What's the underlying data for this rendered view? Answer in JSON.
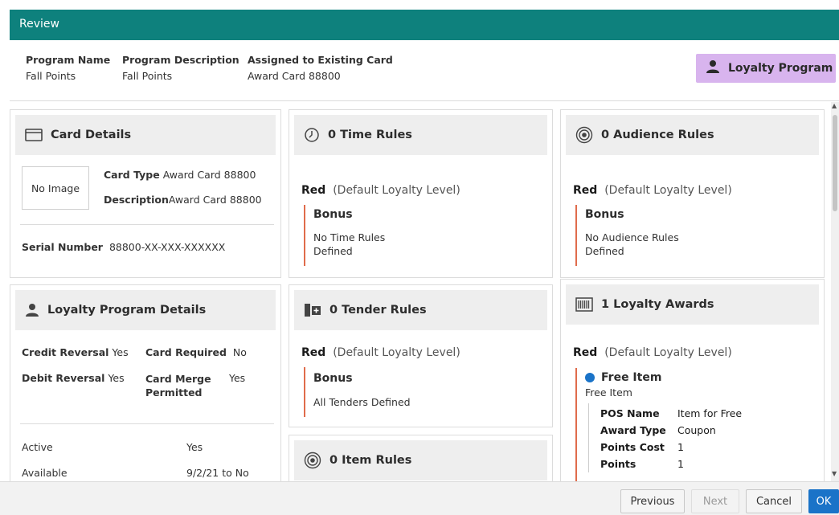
{
  "title": "Review",
  "header": {
    "program_name_label": "Program Name",
    "program_name": "Fall Points",
    "program_desc_label": "Program Description",
    "program_desc": "Fall Points",
    "assigned_label": "Assigned to Existing Card",
    "assigned": "Award Card 88800",
    "badge": "Loyalty Program"
  },
  "card_details": {
    "title": "Card Details",
    "no_image": "No Image",
    "card_type_label": "Card Type",
    "card_type": "Award Card 88800",
    "description_label": "Description",
    "description": "Award Card 88800",
    "serial_label": "Serial Number",
    "serial": "88800-XX-XXX-XXXXXX"
  },
  "loyalty_details": {
    "title": "Loyalty Program Details",
    "credit_reversal_label": "Credit Reversal",
    "credit_reversal": "Yes",
    "card_required_label": "Card Required",
    "card_required": "No",
    "debit_reversal_label": "Debit Reversal",
    "debit_reversal": "Yes",
    "card_merge_label_1": "Card Merge",
    "card_merge_label_2": "Permitted",
    "card_merge": "Yes",
    "active_label": "Active",
    "active": "Yes",
    "available_label": "Available",
    "available": "9/2/21 to No"
  },
  "time_rules": {
    "title": "0 Time Rules",
    "level": "Red",
    "level_sub": "(Default Loyalty Level)",
    "bonus": "Bonus",
    "text_1": "No Time Rules",
    "text_2": "Defined"
  },
  "audience_rules": {
    "title": "0 Audience Rules",
    "level": "Red",
    "level_sub": "(Default Loyalty Level)",
    "bonus": "Bonus",
    "text_1": "No Audience Rules",
    "text_2": "Defined"
  },
  "tender_rules": {
    "title": "0 Tender Rules",
    "level": "Red",
    "level_sub": "(Default Loyalty Level)",
    "bonus": "Bonus",
    "text_1": "All Tenders Defined"
  },
  "item_rules": {
    "title": "0 Item Rules"
  },
  "loyalty_awards": {
    "title": "1 Loyalty Awards",
    "level": "Red",
    "level_sub": "(Default Loyalty Level)",
    "award_name": "Free Item",
    "award_sub": "Free Item",
    "rows": [
      {
        "label": "POS Name",
        "value": "Item for Free"
      },
      {
        "label": "Award Type",
        "value": "Coupon"
      },
      {
        "label": "Points Cost",
        "value": "1"
      },
      {
        "label": "Points",
        "value": "1"
      }
    ]
  },
  "footer": {
    "previous": "Previous",
    "next": "Next",
    "cancel": "Cancel",
    "ok": "OK"
  },
  "colors": {
    "titlebar": "#0e817d",
    "badge": "#d8b4ee",
    "accent_border": "#e06c4c",
    "bullet": "#1a73c8",
    "ok_button": "#1a73c8"
  }
}
